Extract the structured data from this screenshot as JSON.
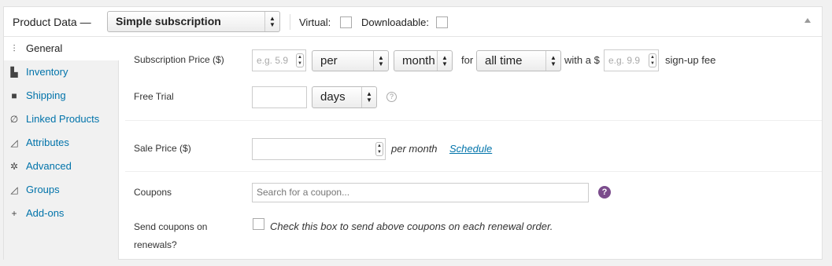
{
  "header": {
    "title": "Product Data —",
    "product_type": "Simple subscription",
    "virtual_label": "Virtual:",
    "downloadable_label": "Downloadable:"
  },
  "sidebar": {
    "items": [
      {
        "label": "General",
        "icon": "sliders-icon",
        "active": true
      },
      {
        "label": "Inventory",
        "icon": "inventory-icon"
      },
      {
        "label": "Shipping",
        "icon": "truck-icon"
      },
      {
        "label": "Linked Products",
        "icon": "link-icon"
      },
      {
        "label": "Attributes",
        "icon": "attributes-icon"
      },
      {
        "label": "Advanced",
        "icon": "gear-icon"
      },
      {
        "label": "Groups",
        "icon": "groups-icon"
      },
      {
        "label": "Add-ons",
        "icon": "plus-icon"
      }
    ]
  },
  "subscription": {
    "price_label": "Subscription Price ($)",
    "price_placeholder": "e.g. 5.9",
    "period_interval": "per",
    "period": "month",
    "for_label": "for",
    "length": "all time",
    "signup_prefix": "with a $",
    "signup_placeholder": "e.g. 9.9",
    "signup_suffix": "sign-up fee"
  },
  "trial": {
    "label": "Free Trial",
    "value": "",
    "period": "days",
    "help": "?"
  },
  "sale": {
    "label": "Sale Price ($)",
    "per_month": "per month",
    "schedule": "Schedule"
  },
  "coupons": {
    "label": "Coupons",
    "placeholder": "Search for a coupon...",
    "help": "?",
    "renewal_label_line1": "Send coupons on",
    "renewal_label_line2": "renewals?",
    "renewal_description": "Check this box to send above coupons on each renewal order."
  }
}
